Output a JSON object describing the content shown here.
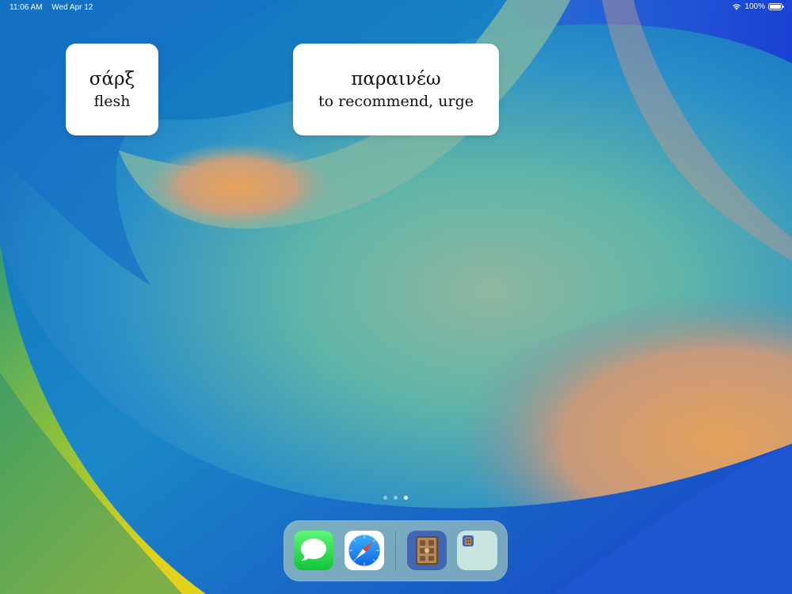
{
  "status_bar": {
    "time": "11:06 AM",
    "date": "Wed Apr 12",
    "battery": "100%",
    "battery_level": 1.0
  },
  "widgets": [
    {
      "term": "σάρξ",
      "gloss": "flesh"
    },
    {
      "term": "παραινέω",
      "gloss": "to recommend, urge"
    }
  ],
  "page_indicator": {
    "pages": 3,
    "current": 3
  },
  "dock": {
    "apps": [
      {
        "icon": "messages-icon"
      },
      {
        "icon": "safari-icon"
      },
      {
        "icon": "book-app-icon"
      },
      {
        "icon": "app-folder-icon"
      }
    ]
  },
  "colors": {
    "messages_green": "#28d94a",
    "safari_blue": "#1a8cf0",
    "book_app_bg": "#4066b4"
  }
}
